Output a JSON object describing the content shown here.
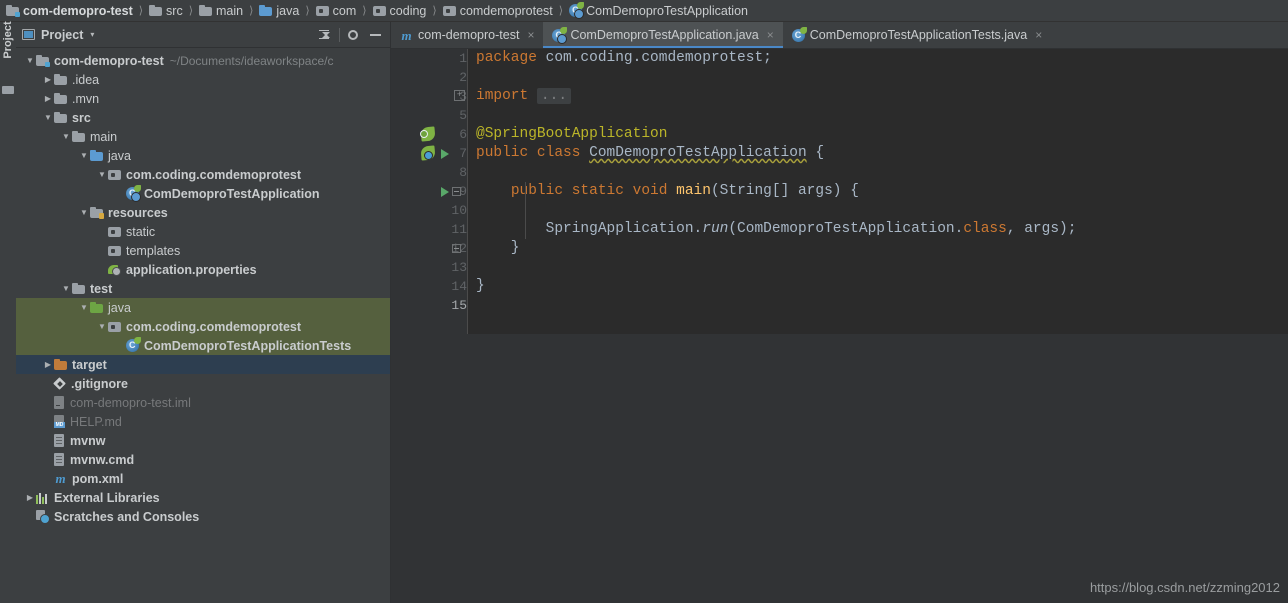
{
  "breadcrumb": [
    {
      "label": "com-demopro-test",
      "icon": "module-folder-icon",
      "bold": true
    },
    {
      "label": "src",
      "icon": "folder-icon",
      "bold": false
    },
    {
      "label": "main",
      "icon": "folder-icon",
      "bold": false
    },
    {
      "label": "java",
      "icon": "source-folder-icon",
      "bold": false
    },
    {
      "label": "com",
      "icon": "package-icon",
      "bold": false
    },
    {
      "label": "coding",
      "icon": "package-icon",
      "bold": false
    },
    {
      "label": "comdemoprotest",
      "icon": "package-icon",
      "bold": false
    },
    {
      "label": "ComDemoproTestApplication",
      "icon": "spring-class-icon",
      "bold": false
    }
  ],
  "tool_window": {
    "vertical_tab": "Project",
    "header": {
      "title": "Project",
      "dropdown_caret": "▾",
      "collapse_all_tooltip": "Collapse All",
      "settings_tooltip": "Settings",
      "hide_tooltip": "Hide"
    }
  },
  "tree": [
    {
      "indent": 0,
      "arrow": "▼",
      "icon": "module-folder-icon",
      "label": "com-demopro-test",
      "bold": true,
      "suffix": "~/Documents/ideaworkspace/c",
      "state": "normal"
    },
    {
      "indent": 1,
      "arrow": "▶",
      "icon": "folder-icon",
      "label": ".idea",
      "bold": false,
      "suffix": "",
      "state": "normal"
    },
    {
      "indent": 1,
      "arrow": "▶",
      "icon": "folder-icon",
      "label": ".mvn",
      "bold": false,
      "suffix": "",
      "state": "normal"
    },
    {
      "indent": 1,
      "arrow": "▼",
      "icon": "folder-icon",
      "label": "src",
      "bold": true,
      "suffix": "",
      "state": "normal"
    },
    {
      "indent": 2,
      "arrow": "▼",
      "icon": "folder-icon",
      "label": "main",
      "bold": false,
      "suffix": "",
      "state": "normal"
    },
    {
      "indent": 3,
      "arrow": "▼",
      "icon": "source-folder-icon",
      "label": "java",
      "bold": false,
      "suffix": "",
      "state": "normal"
    },
    {
      "indent": 4,
      "arrow": "▼",
      "icon": "package-icon",
      "label": "com.coding.comdemoprotest",
      "bold": true,
      "suffix": "",
      "state": "normal"
    },
    {
      "indent": 5,
      "arrow": "",
      "icon": "spring-class-icon",
      "label": "ComDemoproTestApplication",
      "bold": true,
      "suffix": "",
      "state": "normal"
    },
    {
      "indent": 3,
      "arrow": "▼",
      "icon": "resources-folder-icon",
      "label": "resources",
      "bold": true,
      "suffix": "",
      "state": "normal"
    },
    {
      "indent": 4,
      "arrow": "",
      "icon": "package-icon",
      "label": "static",
      "bold": false,
      "suffix": "",
      "state": "normal"
    },
    {
      "indent": 4,
      "arrow": "",
      "icon": "package-icon",
      "label": "templates",
      "bold": false,
      "suffix": "",
      "state": "normal"
    },
    {
      "indent": 4,
      "arrow": "",
      "icon": "properties-icon",
      "label": "application.properties",
      "bold": true,
      "suffix": "",
      "state": "normal"
    },
    {
      "indent": 2,
      "arrow": "▼",
      "icon": "folder-icon",
      "label": "test",
      "bold": true,
      "suffix": "",
      "state": "normal"
    },
    {
      "indent": 3,
      "arrow": "▼",
      "icon": "test-source-folder-icon",
      "label": "java",
      "bold": false,
      "suffix": "",
      "state": "green"
    },
    {
      "indent": 4,
      "arrow": "▼",
      "icon": "package-icon",
      "label": "com.coding.comdemoprotest",
      "bold": true,
      "suffix": "",
      "state": "green"
    },
    {
      "indent": 5,
      "arrow": "",
      "icon": "test-class-icon",
      "label": "ComDemoproTestApplicationTests",
      "bold": true,
      "suffix": "",
      "state": "green"
    },
    {
      "indent": 1,
      "arrow": "▶",
      "icon": "target-folder-icon",
      "label": "target",
      "bold": true,
      "suffix": "",
      "state": "selected"
    },
    {
      "indent": 1,
      "arrow": "",
      "icon": "gitignore-icon",
      "label": ".gitignore",
      "bold": true,
      "suffix": "",
      "state": "normal"
    },
    {
      "indent": 1,
      "arrow": "",
      "icon": "iml-file-icon",
      "label": "com-demopro-test.iml",
      "bold": false,
      "suffix": "",
      "state": "dim"
    },
    {
      "indent": 1,
      "arrow": "",
      "icon": "markdown-file-icon",
      "label": "HELP.md",
      "bold": false,
      "suffix": "",
      "state": "dim"
    },
    {
      "indent": 1,
      "arrow": "",
      "icon": "text-file-icon",
      "label": "mvnw",
      "bold": true,
      "suffix": "",
      "state": "normal"
    },
    {
      "indent": 1,
      "arrow": "",
      "icon": "text-file-icon",
      "label": "mvnw.cmd",
      "bold": true,
      "suffix": "",
      "state": "normal"
    },
    {
      "indent": 1,
      "arrow": "",
      "icon": "maven-icon",
      "label": "pom.xml",
      "bold": true,
      "suffix": "",
      "state": "normal"
    },
    {
      "indent": 0,
      "arrow": "▶",
      "icon": "external-libraries-icon",
      "label": "External Libraries",
      "bold": true,
      "suffix": "",
      "state": "normal"
    },
    {
      "indent": 0,
      "arrow": "",
      "icon": "scratches-icon",
      "label": "Scratches and Consoles",
      "bold": true,
      "suffix": "",
      "state": "normal"
    }
  ],
  "editor_tabs": [
    {
      "label": "com-demopro-test",
      "icon": "maven-icon",
      "active": false,
      "close": "×"
    },
    {
      "label": "ComDemoproTestApplication.java",
      "icon": "spring-class-icon",
      "active": true,
      "close": "×"
    },
    {
      "label": "ComDemoproTestApplicationTests.java",
      "icon": "test-class-icon",
      "active": false,
      "close": "×"
    }
  ],
  "code": {
    "line_numbers": [
      "1",
      "2",
      "3",
      "5",
      "6",
      "7",
      "8",
      "9",
      "10",
      "11",
      "12",
      "13",
      "14",
      "15"
    ],
    "current_line": "15",
    "folded_placeholder": "...",
    "fold_expand_glyph": "+",
    "lines": [
      {
        "num": "1",
        "tokens": [
          {
            "t": "package",
            "c": "kw"
          },
          {
            "t": " com.coding.comdemoprotest;",
            "c": "st"
          }
        ]
      },
      {
        "num": "2",
        "tokens": []
      },
      {
        "num": "3",
        "tokens": [
          {
            "t": "import",
            "c": "kw"
          },
          {
            "t": " ",
            "c": "st"
          },
          {
            "t": "...",
            "c": "dots"
          }
        ]
      },
      {
        "num": "5",
        "tokens": []
      },
      {
        "num": "6",
        "tokens": [
          {
            "t": "@SpringBootApplication",
            "c": "an"
          }
        ]
      },
      {
        "num": "7",
        "tokens": [
          {
            "t": "public class",
            "c": "kw"
          },
          {
            "t": " ",
            "c": "st"
          },
          {
            "t": "ComDemoproTestApplication",
            "c": "warn"
          },
          {
            "t": " {",
            "c": "st"
          }
        ]
      },
      {
        "num": "8",
        "tokens": []
      },
      {
        "num": "9",
        "tokens": [
          {
            "t": "    ",
            "c": "st"
          },
          {
            "t": "public static void",
            "c": "kw"
          },
          {
            "t": " ",
            "c": "st"
          },
          {
            "t": "main",
            "c": "fn"
          },
          {
            "t": "(String[] args) {",
            "c": "st"
          }
        ]
      },
      {
        "num": "10",
        "tokens": []
      },
      {
        "num": "11",
        "tokens": [
          {
            "t": "        SpringApplication.",
            "c": "st"
          },
          {
            "t": "run",
            "c": "it"
          },
          {
            "t": "(ComDemoproTestApplication.",
            "c": "st"
          },
          {
            "t": "class",
            "c": "kw"
          },
          {
            "t": ", args);",
            "c": "st"
          }
        ]
      },
      {
        "num": "12",
        "tokens": [
          {
            "t": "    }",
            "c": "st"
          }
        ]
      },
      {
        "num": "13",
        "tokens": []
      },
      {
        "num": "14",
        "tokens": [
          {
            "t": "}",
            "c": "st"
          }
        ]
      },
      {
        "num": "15",
        "tokens": []
      }
    ]
  },
  "watermark": "https://blog.csdn.net/zzming2012",
  "colors": {
    "panel_bg": "#3C3F41",
    "editor_bg": "#2B2B2B",
    "gutter_bg": "#313335",
    "selection_blue": "#2D3E50",
    "test_scope_green": "#55603E",
    "active_tab_underline": "#4A88C7",
    "keyword_orange": "#CC7832",
    "annotation_yellow": "#BBB529",
    "method_yellow": "#FFC66D",
    "text_grey": "#A9B7C6"
  }
}
